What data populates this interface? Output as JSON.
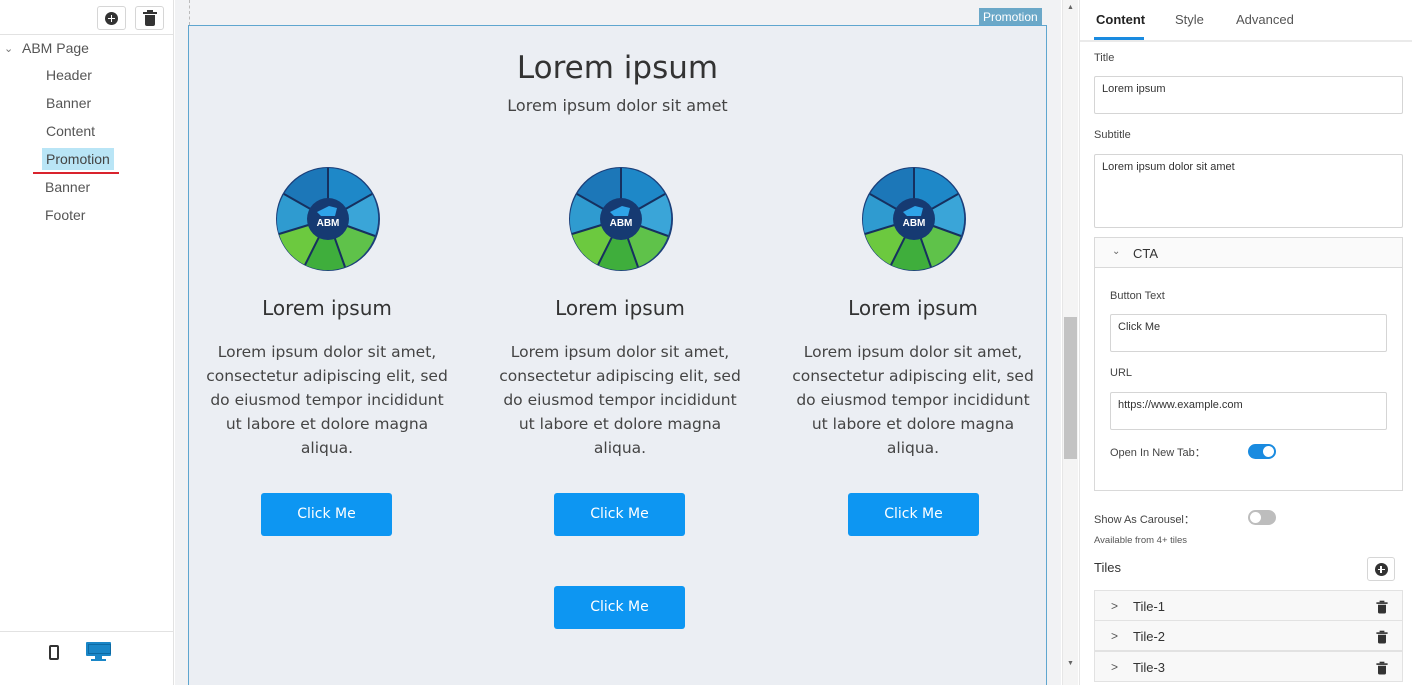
{
  "left_panel": {
    "tree_root": "ABM Page",
    "tree_items": [
      "Header",
      "Banner",
      "Content",
      "Promotion",
      "Banner",
      "Footer"
    ],
    "active_item_index": 3
  },
  "canvas": {
    "section_tag": "Promotion",
    "title": "Lorem ipsum",
    "subtitle": "Lorem ipsum dolor sit amet",
    "tiles": [
      {
        "logo_text": "ABM",
        "title": "Lorem ipsum",
        "text": "Lorem ipsum dolor sit amet, consectetur adipiscing elit, sed do eiusmod tempor incididunt ut labore et dolore magna aliqua.",
        "button": "Click Me"
      },
      {
        "logo_text": "ABM",
        "title": "Lorem ipsum",
        "text": "Lorem ipsum dolor sit amet, consectetur adipiscing elit, sed do eiusmod tempor incididunt ut labore et dolore magna aliqua.",
        "button": "Click Me"
      },
      {
        "logo_text": "ABM",
        "title": "Lorem ipsum",
        "text": "Lorem ipsum dolor sit amet, consectetur adipiscing elit, sed do eiusmod tempor incididunt ut labore et dolore magna aliqua.",
        "button": "Click Me"
      }
    ],
    "section_button": "Click Me"
  },
  "right_panel": {
    "tabs": [
      "Content",
      "Style",
      "Advanced"
    ],
    "active_tab": "Content",
    "title_label": "Title",
    "title_value": "Lorem ipsum",
    "subtitle_label": "Subtitle",
    "subtitle_value": "Lorem ipsum dolor sit amet",
    "cta": {
      "header": "CTA",
      "button_text_label": "Button Text",
      "button_text_value": "Click Me",
      "url_label": "URL",
      "url_value": "https://www.example.com",
      "new_tab_label": "Open In New Tab：",
      "new_tab_on": true
    },
    "carousel_label": "Show As Carousel：",
    "carousel_on": false,
    "carousel_note": "Available from 4+ tiles",
    "tiles_label": "Tiles",
    "tile_rows": [
      "Tile-1",
      "Tile-2",
      "Tile-3"
    ]
  },
  "colors": {
    "accent": "#1a8be0",
    "cta_button": "#0d96f2",
    "active_tree": "#b9e5f6",
    "section_border": "#5fa6cf",
    "red_underline": "#d9232d"
  }
}
